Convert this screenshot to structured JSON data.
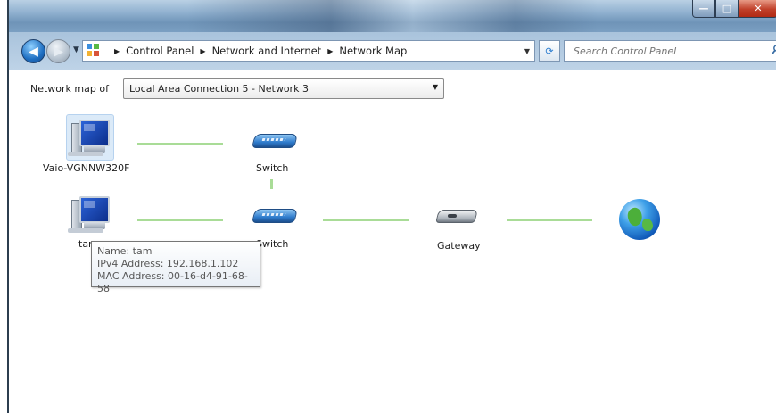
{
  "window": {
    "minimize_glyph": "—",
    "maximize_glyph": "□",
    "close_glyph": "✕"
  },
  "navigation": {
    "breadcrumbs": [
      "Control Panel",
      "Network and Internet",
      "Network Map"
    ],
    "search_placeholder": "Search Control Panel"
  },
  "network_map": {
    "label": "Network map of",
    "selected_network": "Local Area Connection 5 - Network  3"
  },
  "devices": {
    "computer_1": "Vaio-VGNNW320F",
    "switch_1": "Switch",
    "computer_2": "tam",
    "switch_2": "Switch",
    "gateway": "Gateway"
  },
  "tooltip": {
    "name_line": "Name: tam",
    "ipv4_line": "IPv4 Address: 192.168.1.102",
    "mac_line": "MAC Address: 00-16-d4-91-68-58"
  },
  "colors": {
    "link_line": "#a9dc97",
    "selection_fill": "#dbeaf8"
  },
  "icons": [
    "back-icon",
    "forward-icon",
    "control-panel-icon",
    "refresh-icon",
    "search-icon",
    "computer-icon",
    "switch-icon",
    "gateway-icon",
    "internet-globe-icon"
  ]
}
